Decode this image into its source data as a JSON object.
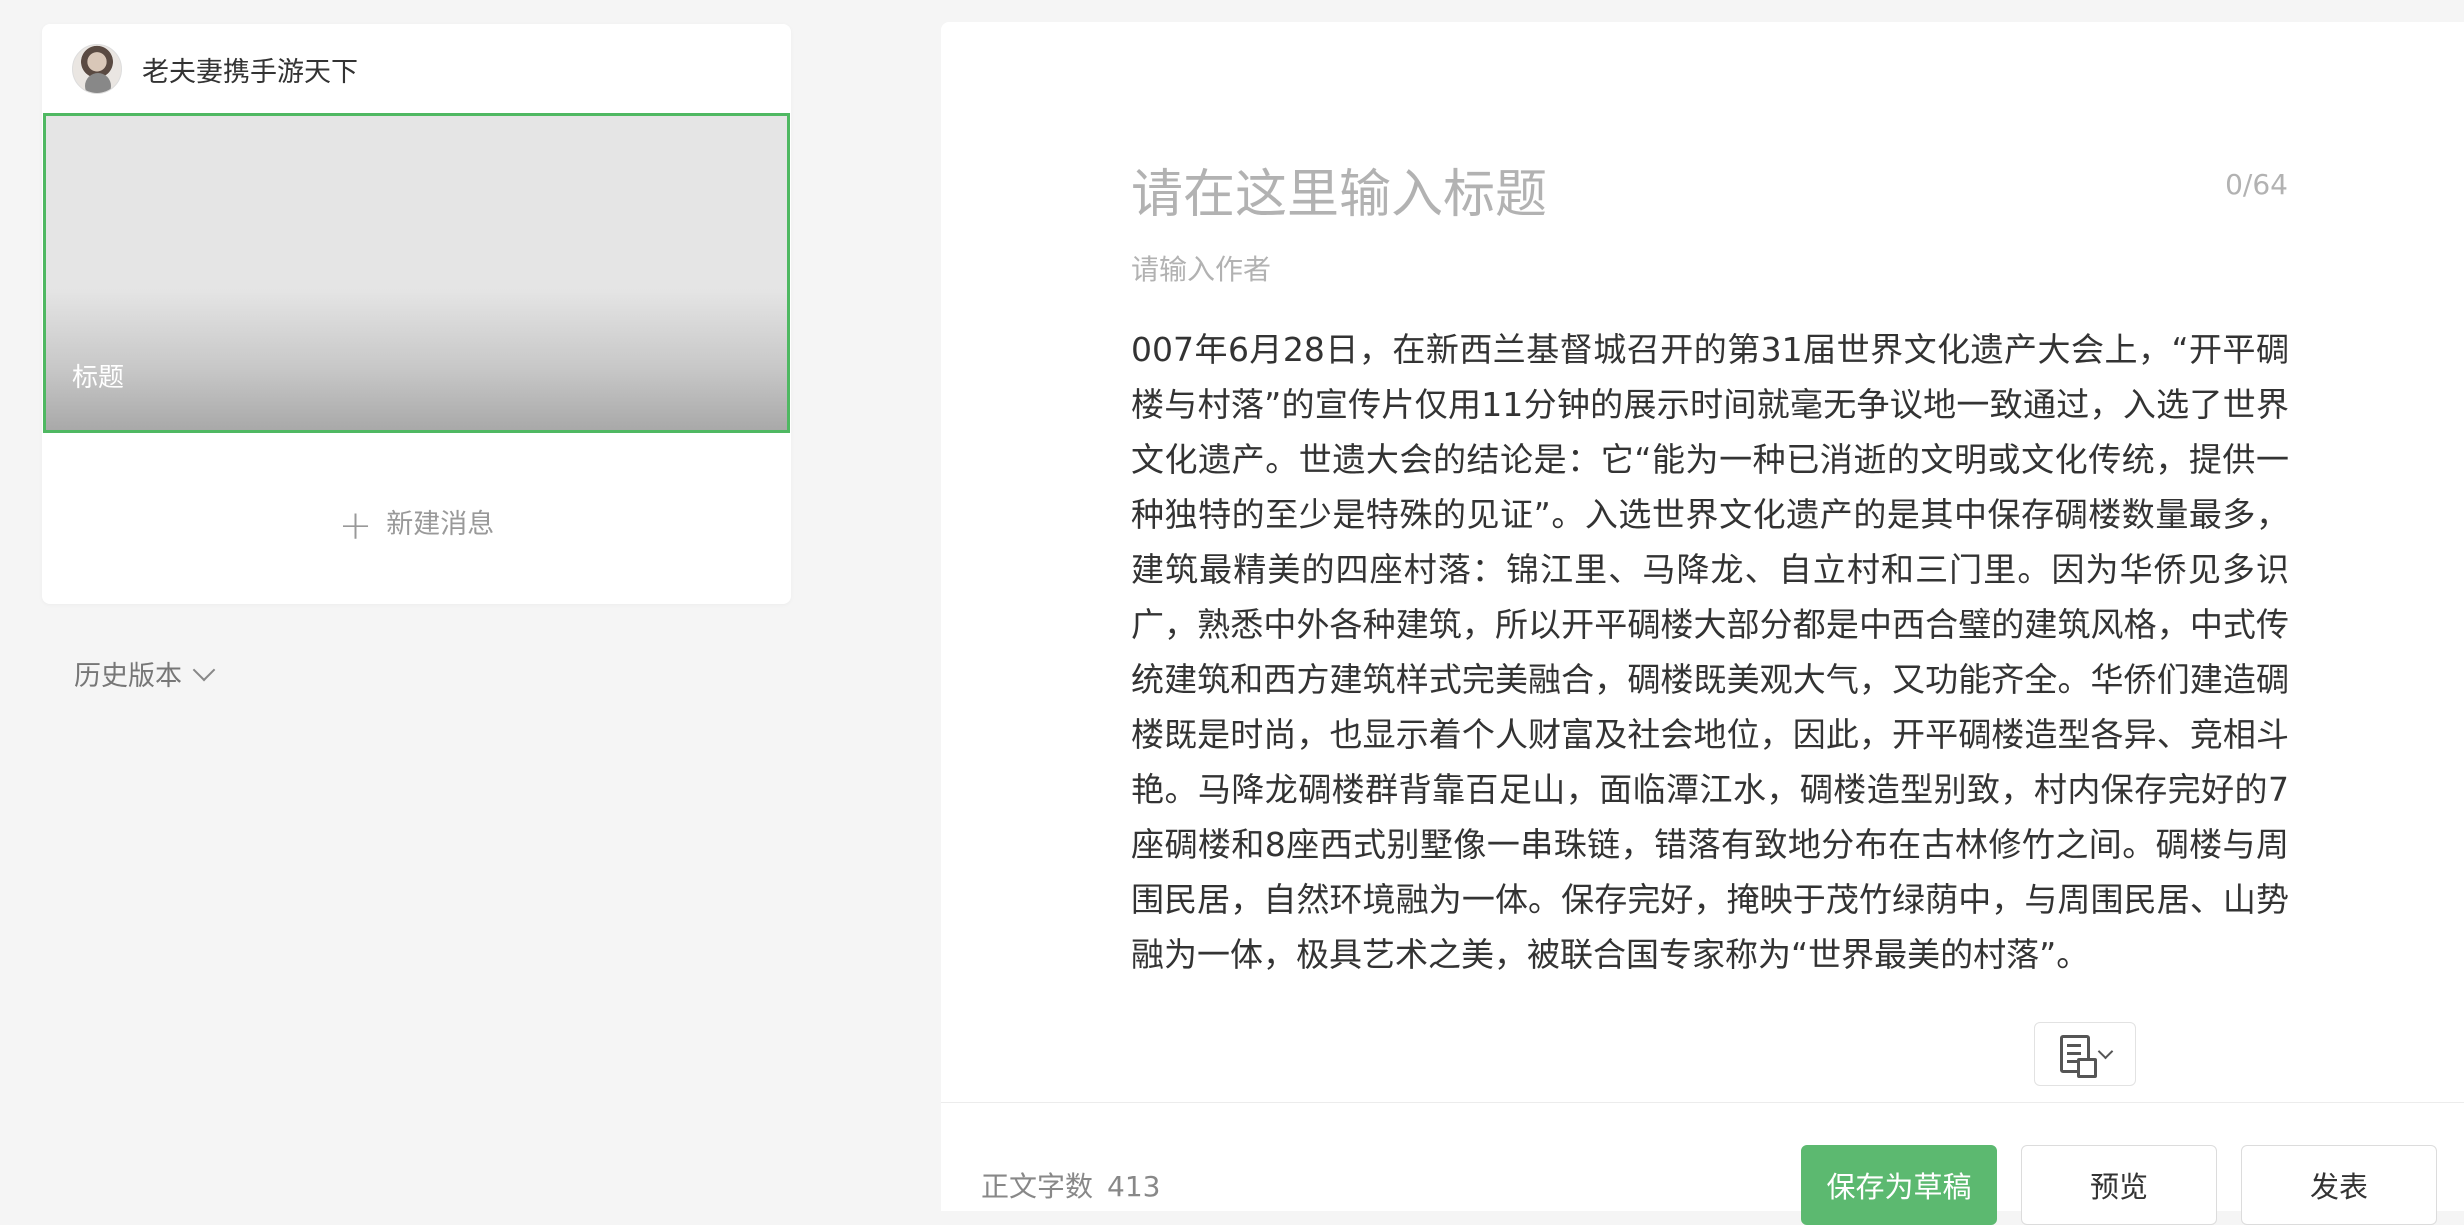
{
  "account": {
    "name": "老夫妻携手游天下"
  },
  "cover": {
    "title": "标题"
  },
  "new_message": {
    "label": "新建消息"
  },
  "history": {
    "label": "历史版本"
  },
  "editor": {
    "title_placeholder": "请在这里输入标题",
    "title_counter": "0/64",
    "author_placeholder": "请输入作者",
    "body": "007年6月28日，在新西兰基督城召开的第31届世界文化遗产大会上，“开平碉楼与村落”的宣传片仅用11分钟的展示时间就毫无争议地一致通过，入选了世界文化遗产。世遗大会的结论是：它“能为一种已消逝的文明或文化传统，提供一种独特的至少是特殊的见证”。入选世界文化遗产的是其中保存碉楼数量最多，建筑最精美的四座村落：锦江里、马降龙、自立村和三门里。因为华侨见多识广，熟悉中外各种建筑，所以开平碉楼大部分都是中西合璧的建筑风格，中式传统建筑和西方建筑样式完美融合，碉楼既美观大气，又功能齐全。华侨们建造碉楼既是时尚，也显示着个人财富及社会地位，因此，开平碉楼造型各异、竞相斗艳。马降龙碉楼群背靠百足山，面临潭江水，碉楼造型别致，村内保存完好的7座碉楼和8座西式别墅像一串珠链，错落有致地分布在古林修竹之间。碉楼与周围民居，自然环境融为一体。保存完好，掩映于茂竹绿荫中，与周围民居、山势融为一体，极具艺术之美，被联合国专家称为“世界最美的村落”。"
  },
  "footer": {
    "word_count_label": "正文字数",
    "word_count_value": "413",
    "save_draft_label": "保存为草稿",
    "preview_label": "预览",
    "publish_label": "发表"
  },
  "colors": {
    "accent_green": "#5cb970",
    "cover_border": "#4fb862"
  }
}
